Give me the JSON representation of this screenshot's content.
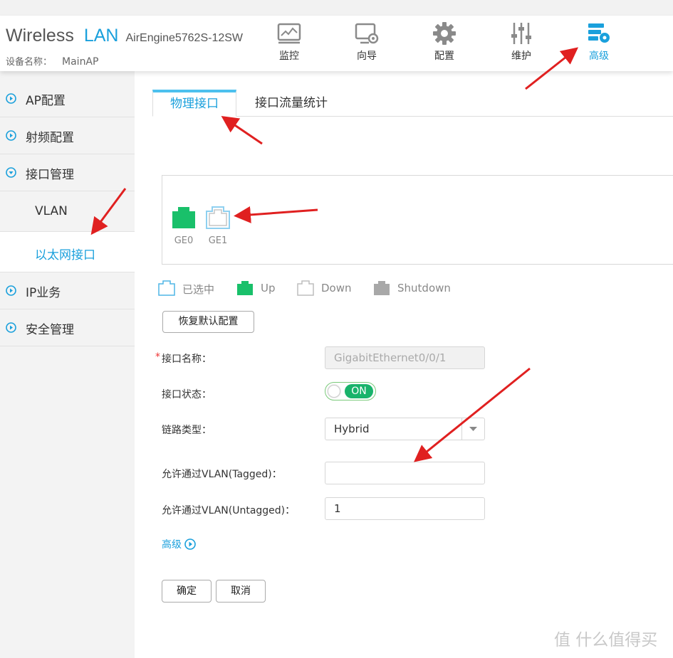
{
  "header": {
    "brand_wireless": "Wireless",
    "brand_lan": "LAN",
    "brand_model": "AirEngine5762S-12SW",
    "device_label": "设备名称：",
    "device_name": "MainAP"
  },
  "nav": [
    {
      "label": "监控",
      "icon": "monitor-icon"
    },
    {
      "label": "向导",
      "icon": "wizard-icon"
    },
    {
      "label": "配置",
      "icon": "gear-icon"
    },
    {
      "label": "维护",
      "icon": "sliders-icon"
    },
    {
      "label": "高级",
      "icon": "server-gear-icon",
      "active": true
    }
  ],
  "sidebar": {
    "items": [
      "AP配置",
      "射频配置",
      "接口管理",
      "IP业务",
      "安全管理"
    ],
    "sub_items": [
      "VLAN",
      "以太网接口"
    ]
  },
  "tabs": [
    "物理接口",
    "接口流量统计"
  ],
  "ports": [
    "GE0",
    "GE1"
  ],
  "legend": [
    "已选中",
    "Up",
    "Down",
    "Shutdown"
  ],
  "colors": {
    "accent": "#1aa0dc",
    "up": "#19c06a",
    "shutdown": "#a8a8a8"
  },
  "restore_button": "恢复默认配置",
  "form": {
    "name_label": "接口名称：",
    "name_value": "GigabitEthernet0/0/1",
    "status_label": "接口状态：",
    "status_value": "ON",
    "link_type_label": "链路类型：",
    "link_type_value": "Hybrid",
    "tagged_label": "允许通过VLAN(Tagged)：",
    "tagged_value": "",
    "untagged_label": "允许通过VLAN(Untagged)：",
    "untagged_value": "1",
    "advanced_label": "高级"
  },
  "buttons": {
    "ok": "确定",
    "cancel": "取消"
  },
  "watermark": "值 什么值得买"
}
